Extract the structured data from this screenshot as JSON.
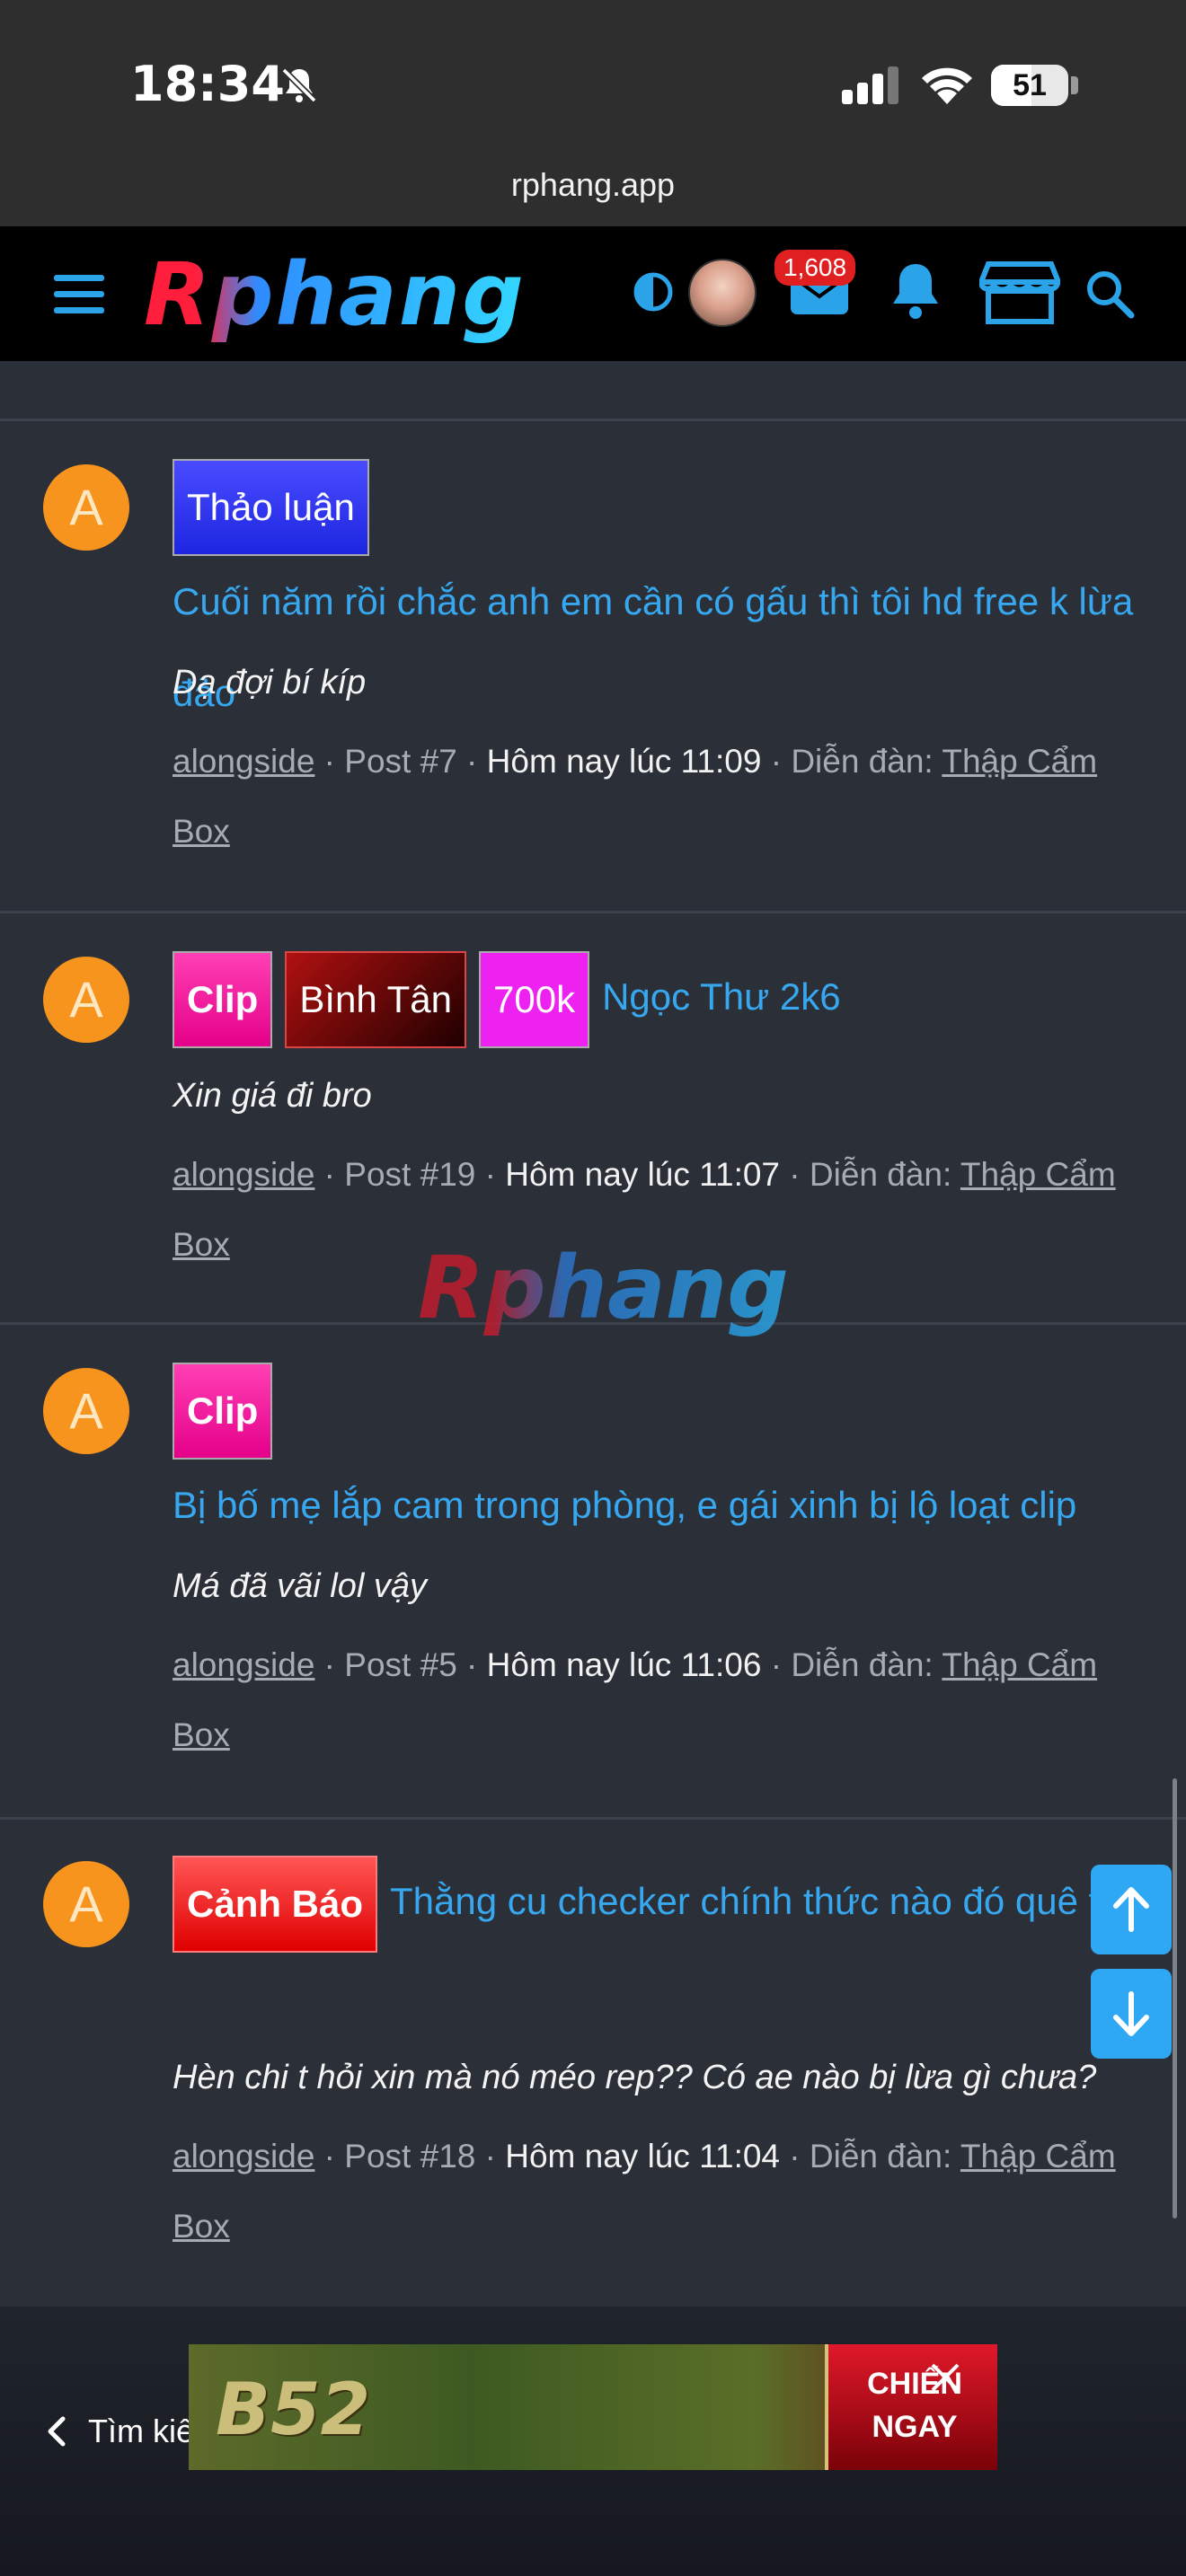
{
  "status": {
    "time": "18:34",
    "battery": "51"
  },
  "browser": {
    "url": "rphang.app"
  },
  "header": {
    "logo": "Rphang",
    "mail_badge": "1,608"
  },
  "watermark": "Rphang",
  "posts": [
    {
      "avatar": "A",
      "tags": [
        "Thảo luận"
      ],
      "title": "Cuối năm rồi chắc anh em cần có gấu thì tôi hd free k lừa đảo",
      "snippet": "Dạ đợi bí kíp",
      "author": "alongside",
      "post": "Post #7",
      "time": "Hôm nay lúc 11:09",
      "forum_label": "Diễn đàn:",
      "forum": "Thập Cẩm Box"
    },
    {
      "avatar": "A",
      "tags": [
        "Clip",
        "Bình Tân",
        "700k"
      ],
      "title": "Ngọc Thư 2k6",
      "snippet": "Xin giá đi bro",
      "author": "alongside",
      "post": "Post #19",
      "time": "Hôm nay lúc 11:07",
      "forum_label": "Diễn đàn:",
      "forum": "Thập Cẩm Box"
    },
    {
      "avatar": "A",
      "tags": [
        "Clip"
      ],
      "title": "Bị bố mẹ lắp cam trong phòng, e gái xinh bị lộ loạt clip",
      "snippet": "Má đã vãi lol vậy",
      "author": "alongside",
      "post": "Post #5",
      "time": "Hôm nay lúc 11:06",
      "forum_label": "Diễn đàn:",
      "forum": "Thập Cẩm Box"
    },
    {
      "avatar": "A",
      "tags": [
        "Cảnh Báo"
      ],
      "title": "Thằng cu checker chính thức nào đó quê tên",
      "snippet": "Hèn chi t hỏi xin mà nó méo rep?? Có ae nào bị lừa gì chưa?",
      "author": "alongside",
      "post": "Post #18",
      "time": "Hôm nay lúc 11:04",
      "forum_label": "Diễn đàn:",
      "forum": "Thập Cẩm Box"
    }
  ],
  "bottom": {
    "back_label": "Tìm kiế",
    "ad_brand": "B52",
    "ad_cta_line1": "CHIẾN",
    "ad_cta_line2": "NGAY"
  },
  "colors": {
    "accent": "#2aa3e8",
    "link": "#37a8f0",
    "background": "#2b2f38",
    "avatar": "#f7941d"
  }
}
